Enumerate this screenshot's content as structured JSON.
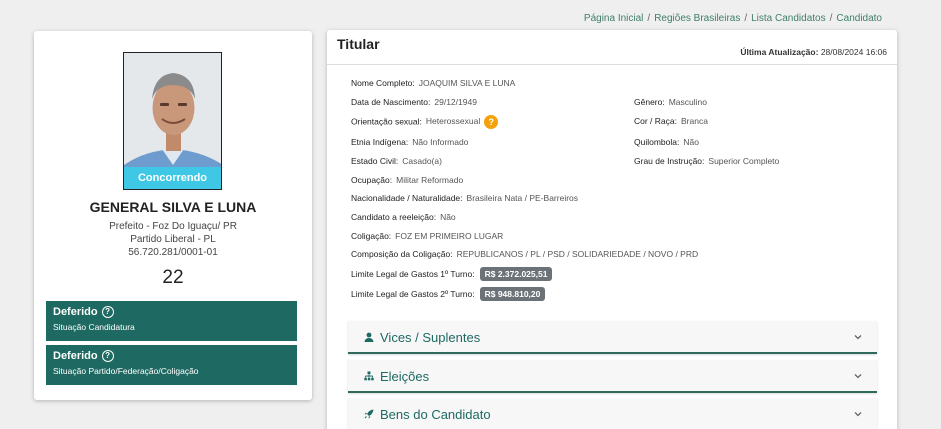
{
  "breadcrumb": {
    "items": [
      "Página Inicial",
      "Regiões Brasileiras",
      "Lista Candidatos",
      "Candidato"
    ],
    "separator": "/"
  },
  "candidate": {
    "photo_badge": "Concorrendo",
    "name": "GENERAL SILVA E LUNA",
    "office": "Prefeito - Foz Do Iguaçu/ PR",
    "party": "Partido Liberal - PL",
    "cnpj": "56.720.281/0001-01",
    "number": "22",
    "status": [
      {
        "title": "Deferido",
        "subtitle": "Situação Candidatura"
      },
      {
        "title": "Deferido",
        "subtitle": "Situação Partido/Federação/Coligação"
      }
    ]
  },
  "titular": {
    "title": "Titular",
    "update_label": "Última Atualização:",
    "update_value": "28/08/2024 16:06",
    "fields": {
      "nome_completo": {
        "label": "Nome Completo:",
        "value": "JOAQUIM SILVA E LUNA"
      },
      "data_nascimento": {
        "label": "Data de Nascimento:",
        "value": "29/12/1949"
      },
      "genero": {
        "label": "Gênero:",
        "value": "Masculino"
      },
      "orientacao": {
        "label": "Orientação sexual:",
        "value": "Heterossexual"
      },
      "cor_raca": {
        "label": "Cor / Raça:",
        "value": "Branca"
      },
      "etnia": {
        "label": "Etnia Indígena:",
        "value": "Não Informado"
      },
      "quilombola": {
        "label": "Quilombola:",
        "value": "Não"
      },
      "estado_civil": {
        "label": "Estado Civil:",
        "value": "Casado(a)"
      },
      "instrucao": {
        "label": "Grau de Instrução:",
        "value": "Superior Completo"
      },
      "ocupacao": {
        "label": "Ocupação:",
        "value": "Militar Reformado"
      },
      "nacionalidade": {
        "label": "Nacionalidade / Naturalidade:",
        "value": "Brasileira Nata / PE-Barreiros"
      },
      "reeleicao": {
        "label": "Candidato a reeleição:",
        "value": "Não"
      },
      "coligacao": {
        "label": "Coligação:",
        "value": "FOZ EM PRIMEIRO LUGAR"
      },
      "composicao": {
        "label": "Composição da Coligação:",
        "value": "REPUBLICANOS / PL / PSD / SOLIDARIEDADE / NOVO / PRD"
      },
      "limite1": {
        "label": "Limite Legal de Gastos 1º Turno:",
        "value": "R$ 2.372.025,51"
      },
      "limite2": {
        "label": "Limite Legal de Gastos 2º Turno:",
        "value": "R$ 948.810,20"
      }
    },
    "help_icon_text": "?"
  },
  "accordions": [
    {
      "label": "Vices / Suplentes",
      "icon": "user-icon"
    },
    {
      "label": "Eleições",
      "icon": "sitemap-icon"
    },
    {
      "label": "Bens do Candidato",
      "icon": "rocket-icon"
    }
  ],
  "colors": {
    "accent": "#1e6a62",
    "badge": "#3fc8e6",
    "help": "#f4a10a",
    "money": "#6b7379"
  }
}
